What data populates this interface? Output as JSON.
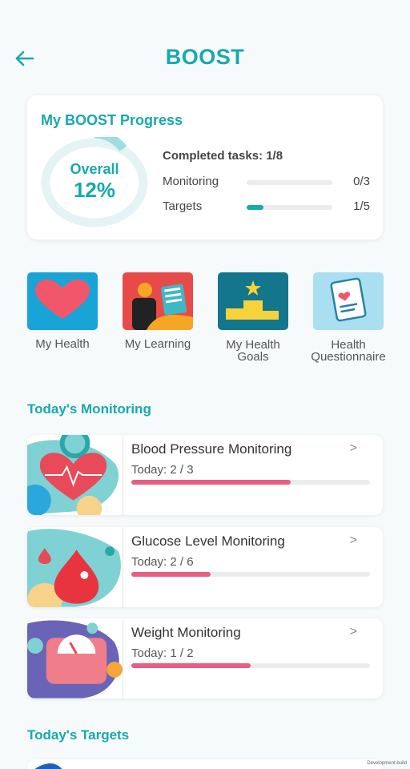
{
  "header": {
    "title": "BOOST",
    "back_icon": "arrow-left-icon",
    "accent_color": "#17a8b0"
  },
  "progress": {
    "title": "My BOOST Progress",
    "overall_label": "Overall",
    "overall_value": "12%",
    "overall_fraction": 0.12,
    "completed_label": "Completed tasks: 1/8",
    "monitoring": {
      "label": "Monitoring",
      "value": "0/3",
      "fraction": 0
    },
    "targets": {
      "label": "Targets",
      "value": "1/5",
      "fraction": 0.2
    }
  },
  "tiles": [
    {
      "label_line1": "My Health",
      "label_line2": "",
      "icon": "heart-icon"
    },
    {
      "label_line1": "My Learning",
      "label_line2": "",
      "icon": "learning-icon"
    },
    {
      "label_line1": "My Health",
      "label_line2": "Goals",
      "icon": "podium-icon"
    },
    {
      "label_line1": "Health",
      "label_line2": "Questionnaire",
      "icon": "questionnaire-icon"
    }
  ],
  "monitoring_section": {
    "title": "Today's Monitoring",
    "items": [
      {
        "title": "Blood Pressure Monitoring",
        "today": "Today: 2 / 3",
        "fraction": 0.6667,
        "icon": "heart-pulse-icon"
      },
      {
        "title": "Glucose Level Monitoring",
        "today": "Today: 2 / 6",
        "fraction": 0.3333,
        "icon": "blood-drop-icon"
      },
      {
        "title": "Weight Monitoring",
        "today": "Today: 1 / 2",
        "fraction": 0.5,
        "icon": "scale-icon"
      }
    ],
    "chevron": ">",
    "progress_color": "#e85e83"
  },
  "targets_section": {
    "title": "Today's Targets"
  },
  "dev_badge": "Development build"
}
